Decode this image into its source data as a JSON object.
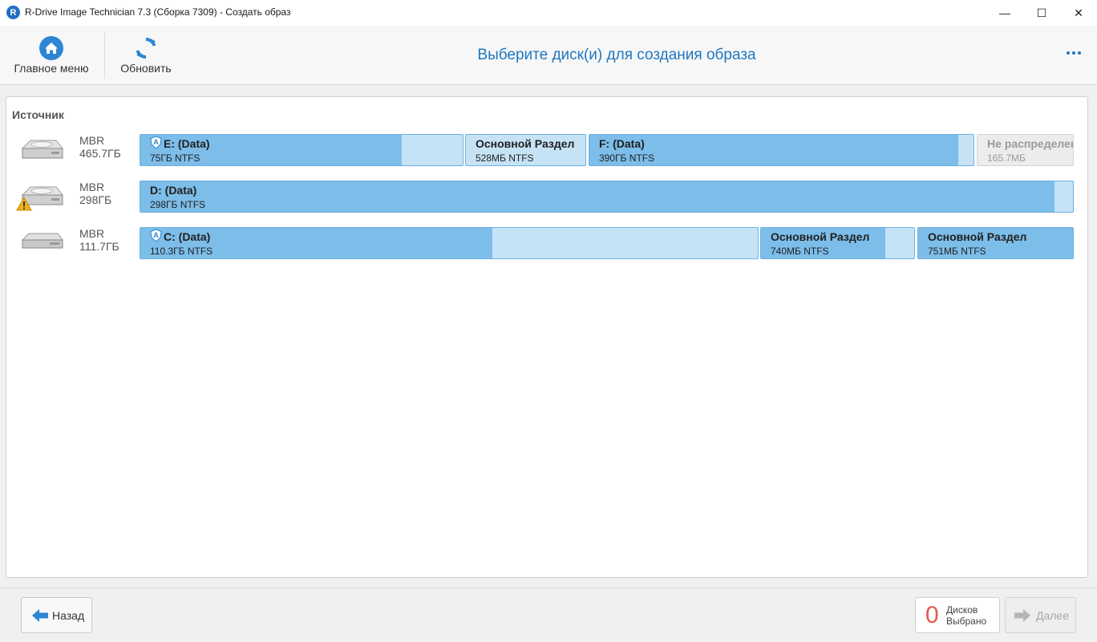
{
  "window": {
    "title": "R-Drive Image Technician 7.3 (Сборка 7309) - Создать образ",
    "app_icon_letter": "R",
    "minimize_glyph": "—",
    "maximize_glyph": "☐",
    "close_glyph": "✕"
  },
  "toolbar": {
    "home_label": "Главное меню",
    "refresh_label": "Обновить",
    "page_title": "Выберите диск(и) для создания образа"
  },
  "source": {
    "label": "Источник",
    "disks": [
      {
        "type": "MBR",
        "size": "465.7ГБ",
        "warning": false,
        "partitions": [
          {
            "name": "E: (Data)",
            "size": "75ГБ NTFS",
            "used": 0.81,
            "shield": true
          },
          {
            "name": "Основной Раздел",
            "size": "528МБ NTFS",
            "used": 0.0,
            "shield": false
          },
          {
            "name": "F: (Data)",
            "size": "390ГБ NTFS",
            "used": 0.96,
            "shield": false
          },
          {
            "name": "Не распределено",
            "size": "165.7МБ",
            "used": 0.0,
            "shield": false,
            "unallocated": true
          }
        ]
      },
      {
        "type": "MBR",
        "size": "298ГБ",
        "warning": true,
        "partitions": [
          {
            "name": "D: (Data)",
            "size": "298ГБ NTFS",
            "used": 0.98,
            "shield": false
          }
        ]
      },
      {
        "type": "MBR",
        "size": "111.7ГБ",
        "warning": false,
        "partitions": [
          {
            "name": "C: (Data)",
            "size": "110.3ГБ NTFS",
            "used": 0.57,
            "shield": true
          },
          {
            "name": "Основной Раздел",
            "size": "740МБ NTFS",
            "used": 0.81,
            "shield": false
          },
          {
            "name": "Основной Раздел",
            "size": "751МБ NTFS",
            "used": 1.0,
            "shield": false
          }
        ]
      }
    ]
  },
  "footer": {
    "back_label": "Назад",
    "selected_count": "0",
    "selected_line1": "Дисков",
    "selected_line2": "Выбрано",
    "next_label": "Далее"
  },
  "colors": {
    "accent": "#2077c0",
    "partition_used": "#7dbde9",
    "partition_free": "#c6e3f6",
    "count": "#e05a4f"
  }
}
